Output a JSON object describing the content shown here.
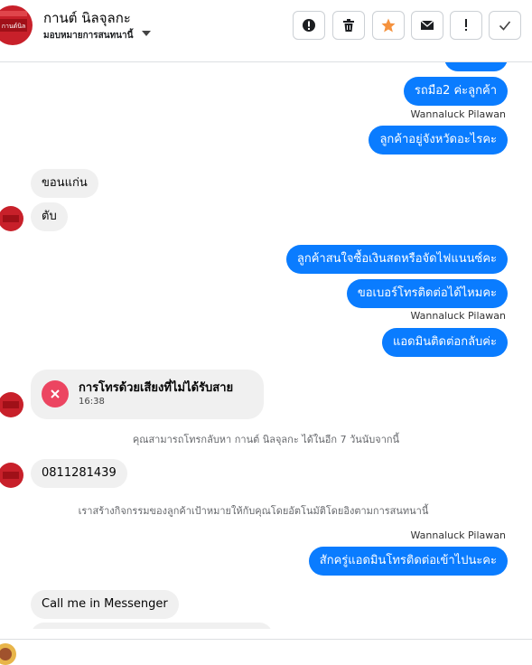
{
  "header": {
    "contact_name": "กานต์ นิลจุลกะ",
    "assign_label": "มอบหมายการสนทนานี้",
    "buttons": [
      {
        "name": "alert-button",
        "icon": "alert-circle-icon"
      },
      {
        "name": "delete-button",
        "icon": "trash-icon"
      },
      {
        "name": "star-button",
        "icon": "star-icon"
      },
      {
        "name": "mark-unread-button",
        "icon": "envelope-icon"
      },
      {
        "name": "spam-button",
        "icon": "exclamation-icon"
      },
      {
        "name": "done-button",
        "icon": "check-icon"
      }
    ]
  },
  "avatar_label": "กานต์นิล",
  "colors": {
    "outgoing_bubble": "#0a7cff",
    "incoming_bubble": "#f0f0f0",
    "missed_call": "#ec4561",
    "star": "#f5923e"
  },
  "messages": {
    "out_1": "รถมือ2 ค่ะลูกค้า",
    "sender_1": "Wannaluck Pilawan",
    "out_2": "ลูกค้าอยู่จังหวัดอะไรคะ",
    "in_1": "ขอนแก่น",
    "in_2": "ตับ",
    "out_3": "ลูกค้าสนใจซื้อเงินสดหรือจัดไฟแนนซ์คะ",
    "out_4": "ขอเบอร์โทรติดต่อได้ไหมคะ",
    "sender_2": "Wannaluck Pilawan",
    "out_5": "แอดมินติดต่อกลับค่ะ",
    "call_title": "การโทรด้วยเสียงที่ไม่ได้รับสาย",
    "call_time": "16:38",
    "system_1": "คุณสามารถโทรกลับหา กานต์ นิลจุลกะ ได้ในอีก 7 วันนับจากนี้",
    "in_3": "0811281439",
    "system_2": "เราสร้างกิจกรรมของลูกค้าเป้าหมายให้กับคุณโดยอัตโนมัติโดยอิงตามการสนทนานี้",
    "sender_3": "Wannaluck Pilawan",
    "out_6": "สักครู่แอดมินโทรติดต่อเข้าไปนะคะ",
    "in_4": "Call me in Messenger"
  }
}
